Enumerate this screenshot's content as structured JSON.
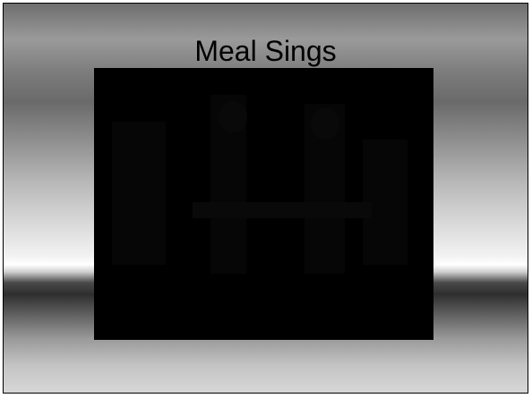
{
  "slide": {
    "title": "Meal Sings",
    "background": "grayscale-gradient",
    "media": {
      "type": "dark-photo",
      "background_color": "#000000"
    }
  }
}
